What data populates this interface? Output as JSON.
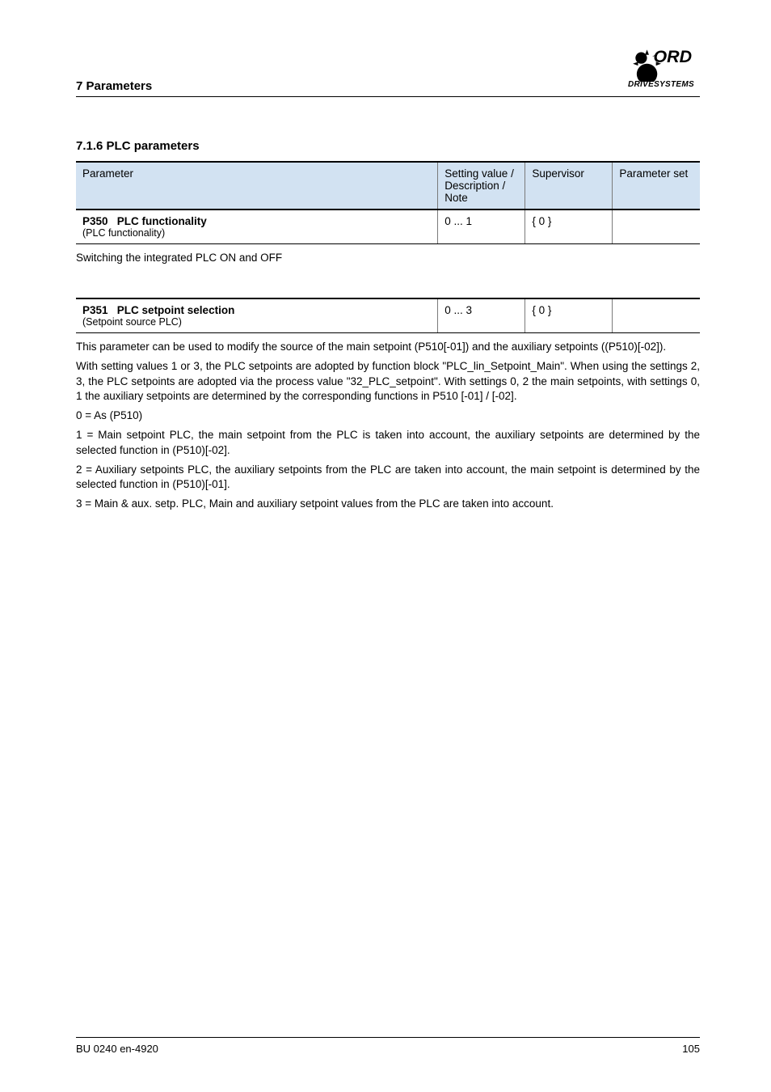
{
  "breadcrumb": "7 Parameters",
  "logo_sub": "DRIVESYSTEMS",
  "section": "7.1.6  PLC parameters",
  "table1": {
    "h1": "Parameter",
    "h2": "Setting value / Description / Note",
    "h3": "Supervisor",
    "h4": "Parameter set",
    "name_code": "P350",
    "name_label": "PLC functionality",
    "name_sub": "(PLC functionality)",
    "c2": "0 ... 1",
    "c3": "{ 0 }",
    "c4": ""
  },
  "p350_on": "Switching the integrated PLC ON and OFF",
  "table2": {
    "name_code": "P351",
    "name_label": "PLC setpoint selection",
    "name_sub": "(Setpoint source PLC)",
    "c2": "0 ... 3",
    "c3": "{ 0 }",
    "c4": ""
  },
  "p351_para1": "This parameter can be used to modify the source of the main setpoint (P510[-01]) and the auxiliary setpoints ((P510)[-02]).",
  "p351_para2": "With setting values 1 or 3, the PLC setpoints are adopted by function block \"PLC_lin_Setpoint_Main\". When using the settings 2, 3, the PLC setpoints are adopted via the process value \"32_PLC_setpoint\". With settings 0, 2 the main setpoints, with settings 0, 1 the auxiliary setpoints are determined by the corresponding functions in P510 [-01] / [-02].",
  "opt0": "0 = As (P510)",
  "opt1": "1 = Main setpoint PLC, the main setpoint from the PLC is taken into account, the auxiliary setpoints are determined by the selected function in (P510)[-02].",
  "opt2": "2 = Auxiliary setpoints PLC, the auxiliary setpoints from the PLC are taken into account, the main setpoint is determined by the selected function in (P510)[-01].",
  "opt3": "3 = Main & aux. setp. PLC, Main and auxiliary setpoint values from the PLC are taken into account.",
  "footer_left": "BU 0240 en-4920",
  "footer_right": "105"
}
